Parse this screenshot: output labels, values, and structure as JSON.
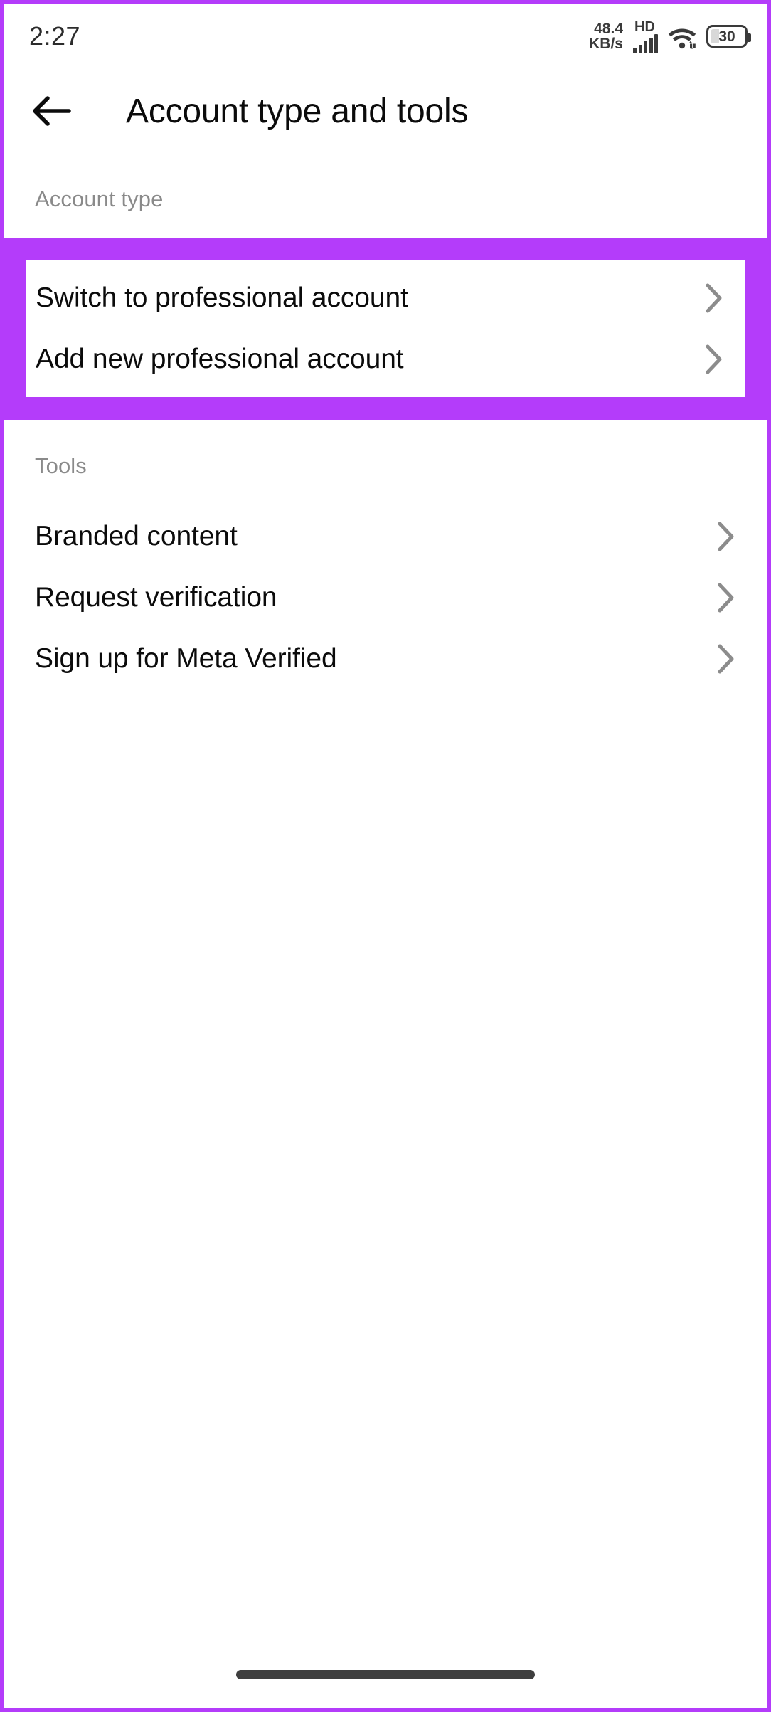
{
  "status_bar": {
    "time": "2:27",
    "network_rate": "48.4",
    "network_unit": "KB/s",
    "network_type": "HD",
    "signal_icon": "signal-bars-icon",
    "wifi_icon": "wifi-icon",
    "battery_level": "30",
    "battery_icon": "battery-icon"
  },
  "header": {
    "back_icon": "back-arrow-icon",
    "title": "Account type and tools"
  },
  "account_type_section": {
    "label": "Account type",
    "highlight_color": "#b43cfa",
    "items": [
      {
        "label": "Switch to professional account",
        "chevron": "chevron-right-icon"
      },
      {
        "label": "Add new professional account",
        "chevron": "chevron-right-icon"
      }
    ]
  },
  "tools_section": {
    "label": "Tools",
    "items": [
      {
        "label": "Branded content",
        "chevron": "chevron-right-icon"
      },
      {
        "label": "Request verification",
        "chevron": "chevron-right-icon"
      },
      {
        "label": "Sign up for Meta Verified",
        "chevron": "chevron-right-icon"
      }
    ]
  },
  "navigation": {
    "gesture_bar": "home-gesture-bar"
  }
}
